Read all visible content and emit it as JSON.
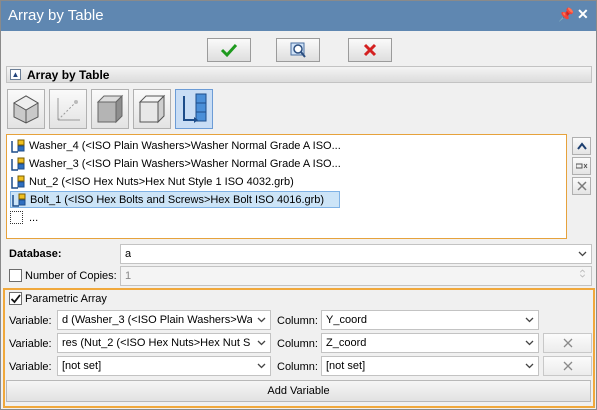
{
  "window": {
    "title": "Array by Table"
  },
  "toolbar": {
    "ok_icon": "checkmark-icon",
    "preview_icon": "preview-icon",
    "cancel_icon": "cancel-x-icon"
  },
  "section": {
    "title": "Array by Table"
  },
  "mode_tools": [
    {
      "name": "cube-iso-tool",
      "active": false
    },
    {
      "name": "axis-path-tool",
      "active": false
    },
    {
      "name": "cube-shaded-tool",
      "active": false
    },
    {
      "name": "cube-outline-tool",
      "active": false
    },
    {
      "name": "table-array-tool",
      "active": true
    }
  ],
  "list": {
    "items": [
      {
        "label": "Washer_4 (<ISO Plain Washers>Washer Normal Grade A ISO..."
      },
      {
        "label": "Washer_3 (<ISO Plain Washers>Washer Normal Grade A ISO..."
      },
      {
        "label": "Nut_2 (<ISO Hex Nuts>Hex Nut Style 1 ISO 4032.grb)"
      },
      {
        "label": "Bolt_1 (<ISO Hex Bolts and Screws>Hex Bolt ISO 4016.grb)"
      }
    ],
    "placeholder_item": "..."
  },
  "database": {
    "label": "Database:",
    "value": "a"
  },
  "copies": {
    "label": "Number of Copies:",
    "value": "1"
  },
  "parametric": {
    "label": "Parametric Array",
    "rows": [
      {
        "var_label": "Variable:",
        "var_value": "d (Washer_3 (<ISO Plain Washers>Wa",
        "col_label": "Column:",
        "col_value": "Y_coord"
      },
      {
        "var_label": "Variable:",
        "var_value": "res (Nut_2 (<ISO Hex Nuts>Hex Nut S",
        "col_label": "Column:",
        "col_value": "Z_coord"
      },
      {
        "var_label": "Variable:",
        "var_value": "[not set]",
        "col_label": "Column:",
        "col_value": "[not set]"
      }
    ],
    "add_label": "Add Variable"
  },
  "colors": {
    "titlebar": "#5f87b1",
    "accent_border": "#f0a83c",
    "ok_green": "#1e9a1e",
    "cancel_red": "#d42020",
    "selection": "#cce4f7"
  }
}
